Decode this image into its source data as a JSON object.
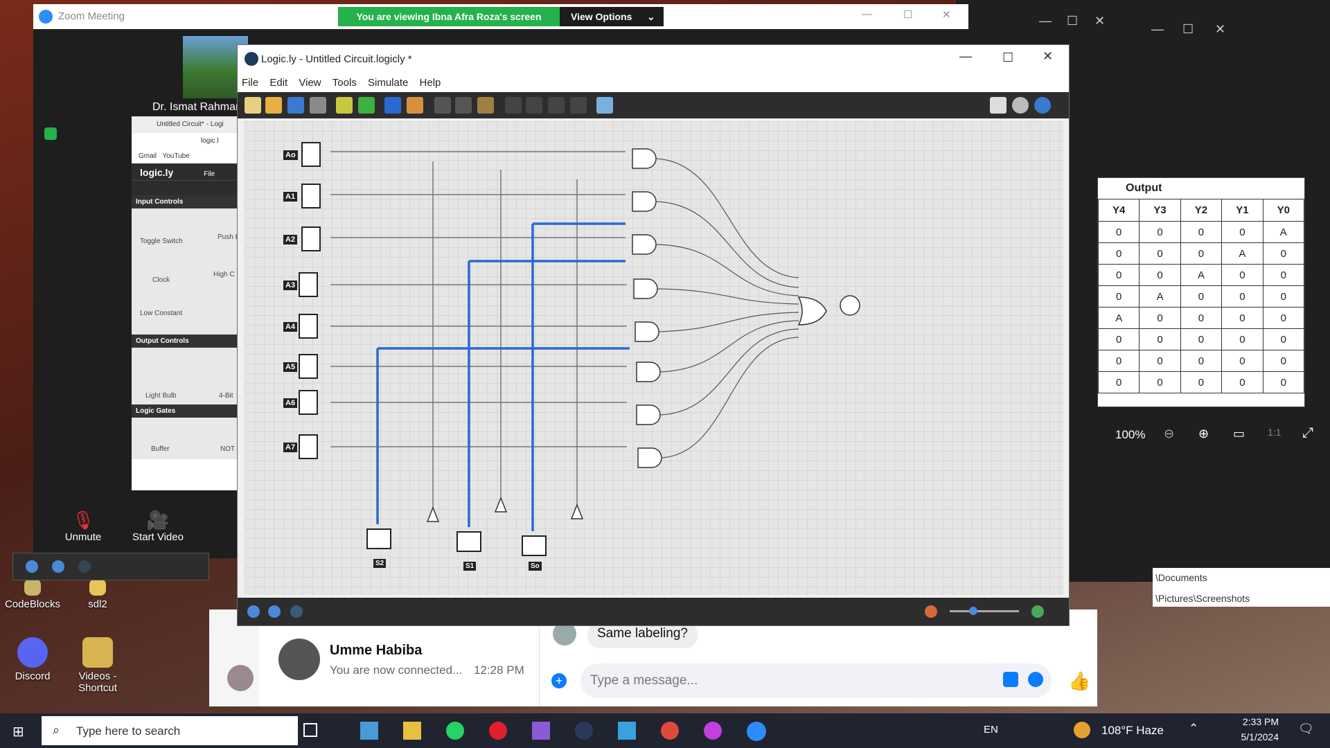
{
  "zoom": {
    "title": "Zoom Meeting",
    "banner": "You are viewing Ibna Afra Roza's screen",
    "view_options": "View Options",
    "participant_name": "Dr. Ismat Rahman",
    "unmute": "Unmute",
    "start_video": "Start Video"
  },
  "mini_browser": {
    "tab": "Untitled Circuit* - Logi",
    "address": "logic.l",
    "bookmarks": [
      "Gmail",
      "YouTube"
    ],
    "app_name": "logic.ly",
    "menu_file": "File",
    "section_input": "Input Controls",
    "toggle_switch": "Toggle Switch",
    "push": "Push B",
    "clock": "Clock",
    "high": "High C",
    "low_constant": "Low Constant",
    "section_output": "Output Controls",
    "light_bulb": "Light Bulb",
    "four_bit": "4-Bit",
    "section_gates": "Logic Gates",
    "buffer": "Buffer",
    "not": "NOT"
  },
  "logicly": {
    "title": "Logic.ly - Untitled Circuit.logicly *",
    "menu": [
      "File",
      "Edit",
      "View",
      "Tools",
      "Simulate",
      "Help"
    ],
    "inputs": [
      "Ao",
      "A1",
      "A2",
      "A3",
      "A4",
      "A5",
      "A6",
      "A7"
    ],
    "selects": [
      "S2",
      "S1",
      "So"
    ]
  },
  "truth_table": {
    "title": "Output",
    "headers": [
      "Y4",
      "Y3",
      "Y2",
      "Y1",
      "Y0"
    ],
    "rows": [
      [
        "0",
        "0",
        "0",
        "0",
        "A"
      ],
      [
        "0",
        "0",
        "0",
        "A",
        "0"
      ],
      [
        "0",
        "0",
        "A",
        "0",
        "0"
      ],
      [
        "0",
        "A",
        "0",
        "0",
        "0"
      ],
      [
        "A",
        "0",
        "0",
        "0",
        "0"
      ],
      [
        "0",
        "0",
        "0",
        "0",
        "0"
      ],
      [
        "0",
        "0",
        "0",
        "0",
        "0"
      ],
      [
        "0",
        "0",
        "0",
        "0",
        "0"
      ]
    ]
  },
  "photos": {
    "zoom_level": "100%",
    "path1": "\\Documents",
    "path2": "\\Pictures\\Screenshots"
  },
  "messenger": {
    "contact_name": "Umme Habiba",
    "contact_status": "You are now connected...",
    "contact_time": "12:28 PM",
    "message": "Same labeling?",
    "input_placeholder": "Type a message..."
  },
  "desktop_icons": [
    "CodeBlocks",
    "sdl2",
    "Discord",
    "Videos - Shortcut"
  ],
  "taskbar": {
    "search_placeholder": "Type here to search",
    "language": "EN",
    "weather": "108°F Haze",
    "time": "2:33 PM",
    "date": "5/1/2024"
  }
}
